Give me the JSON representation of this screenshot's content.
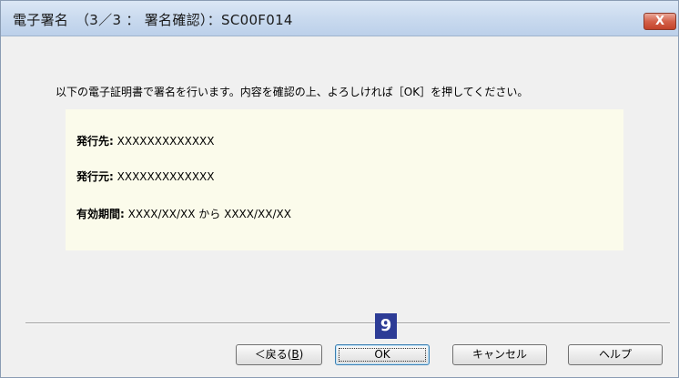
{
  "window": {
    "title": "電子署名　（3／3 ： 署名確認）：SC00F014",
    "close_label": "X"
  },
  "message": "以下の電子証明書で署名を行います。内容を確認の上、よろしければ［OK］を押してください。",
  "certificate": {
    "issued_to_label": "発行先:",
    "issued_to_value": " XXXXXXXXXXXXX",
    "issued_by_label": "発行元:",
    "issued_by_value": " XXXXXXXXXXXXX",
    "validity_label": "有効期間:",
    "validity_value": " XXXX/XX/XX から XXXX/XX/XX"
  },
  "buttons": {
    "back_prefix": "＜戻る(",
    "back_key": "B",
    "back_suffix": ")",
    "ok": "OK",
    "cancel": "キャンセル",
    "help": "ヘルプ"
  },
  "annotation": {
    "step_number": "9"
  },
  "colors": {
    "info_box_bg": "#fbfbeb",
    "badge_bg": "#2d3c96"
  }
}
